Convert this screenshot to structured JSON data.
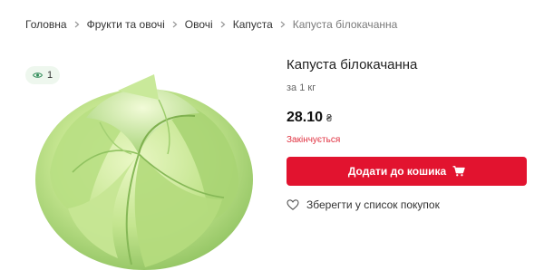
{
  "breadcrumb": {
    "items": [
      "Головна",
      "Фрукти та овочі",
      "Овочі",
      "Капуста"
    ],
    "current": "Капуста білокачанна"
  },
  "views": {
    "count": "1",
    "icon": "eye-icon"
  },
  "product": {
    "title": "Капуста білокачанна",
    "unit": "за 1 кг",
    "price": "28.10",
    "currency": "₴",
    "stock_status": "Закінчується"
  },
  "actions": {
    "add_to_cart": "Додати до кошика",
    "save_to_list": "Зберегти у список покупок"
  },
  "colors": {
    "accent": "#e2132f",
    "stock_warning": "#e0303f",
    "views_badge_bg": "#eef7ee",
    "eye_icon": "#2e8b57"
  }
}
